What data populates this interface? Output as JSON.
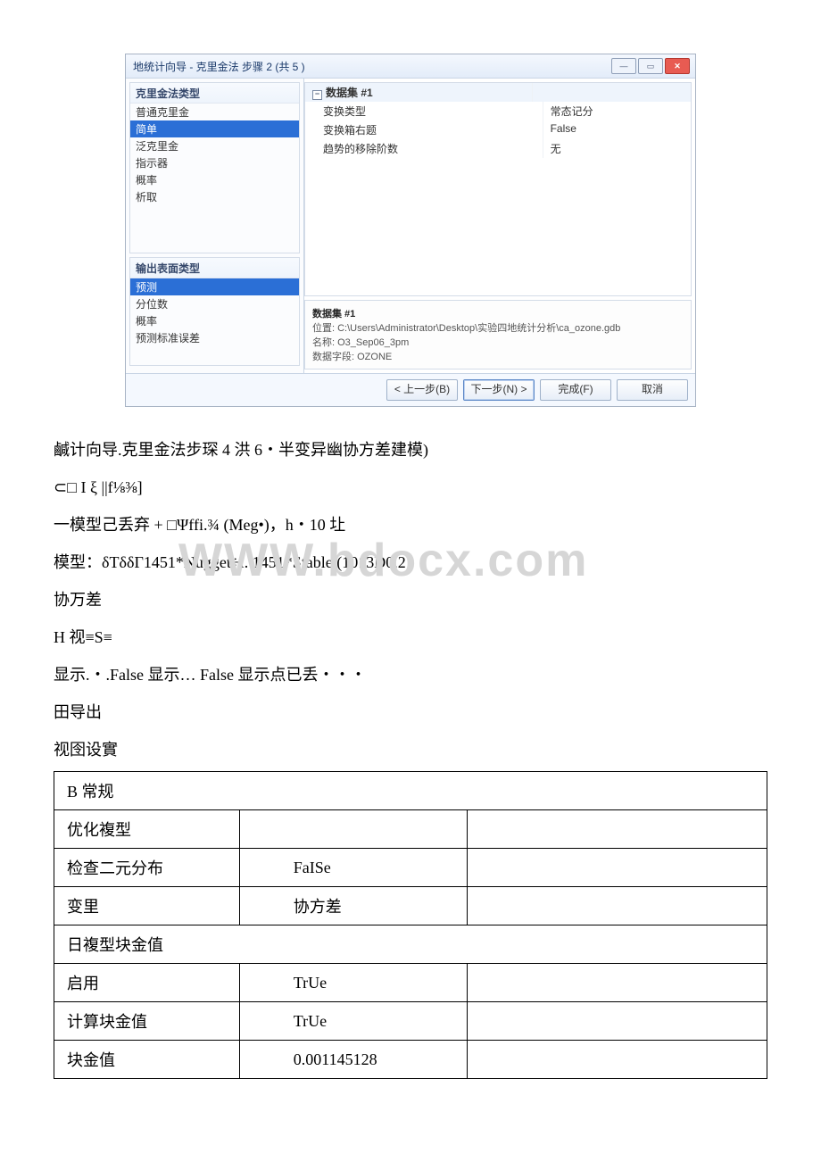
{
  "dialog": {
    "title": "地统计向导 - 克里金法 步骤 2 (共 5 )",
    "win": {
      "min": "—",
      "max": "▭",
      "close": "✕"
    },
    "left": {
      "kriging_title": "克里金法类型",
      "kriging_items": [
        "普通克里金",
        "简单",
        "泛克里金",
        "指示器",
        "概率",
        "析取"
      ],
      "kriging_sel": 1,
      "output_title": "输出表面类型",
      "output_items": [
        "预测",
        "分位数",
        "概率",
        "预测标准误差"
      ],
      "output_sel": 0
    },
    "props": {
      "hdr": "数据集 #1",
      "rows": [
        {
          "k": "变换类型",
          "v": "常态记分"
        },
        {
          "k": "变换箱右题",
          "v": "False"
        },
        {
          "k": "趋势的移除阶数",
          "v": "无"
        }
      ]
    },
    "desc": {
      "title": "数据集 #1",
      "lines": [
        "位置: C:\\Users\\Administrator\\Desktop\\实验四地统计分析\\ca_ozone.gdb",
        "名称: O3_Sep06_3pm",
        "数据字段: OZONE"
      ]
    },
    "buttons": {
      "back": "< 上一步(B)",
      "next": "下一步(N) >",
      "finish": "完成(F)",
      "cancel": "取消"
    }
  },
  "text": {
    "p1": "鹹计向导.克里金法步琛 4 洪 6・半变异幽协方差建模)",
    "p2": "⊂□ I ξ ||f⅛⅜]",
    "p3": "一模型己丢弃 + □Ψffi.¾ (Meg•)，h・10 圵",
    "p4": "模型：δTδδΓ1451*Nugget÷l. 1451*Stable (1013D0,2)",
    "p5": "协万差",
    "p6": "H 视≡S≡",
    "p7": "显示.・.False 显示… False 显示点已丢・・・",
    "p8": "田导出",
    "p9": "视囹设實",
    "wm": "WWW.bdocx.com"
  },
  "table": {
    "r1c1": "B 常规",
    "r2": {
      "c1": "优化複型",
      "c2": "",
      "c3": ""
    },
    "r3": {
      "c1": "检查二元分布",
      "c2": "FaISe",
      "c3": ""
    },
    "r4": {
      "c1": "变里",
      "c2": "协方差",
      "c3": ""
    },
    "r5c1": "日複型块金值",
    "r6": {
      "c1": "启用",
      "c2": "TrUe",
      "c3": ""
    },
    "r7": {
      "c1": "计算块金值",
      "c2": "TrUe",
      "c3": ""
    },
    "r8": {
      "c1": "块金值",
      "c2": "0.001145128",
      "c3": ""
    }
  }
}
